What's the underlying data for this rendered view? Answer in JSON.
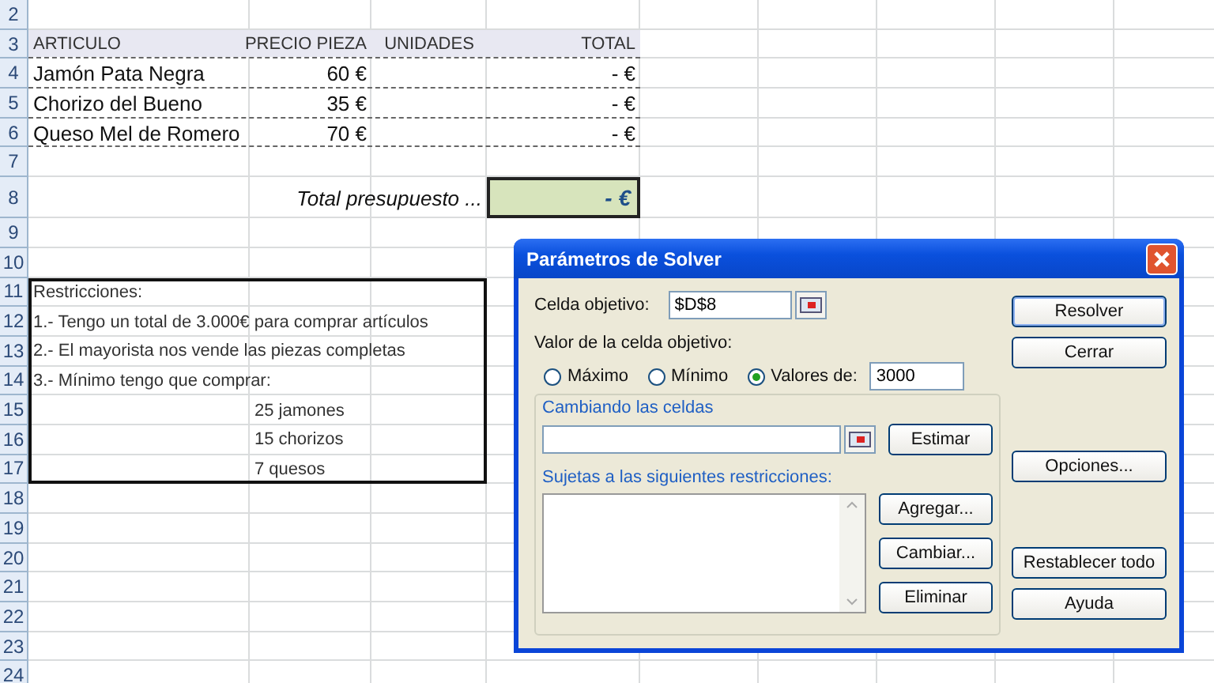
{
  "sheet": {
    "row_numbers": [
      "2",
      "3",
      "4",
      "5",
      "6",
      "7",
      "8",
      "9",
      "10",
      "11",
      "12",
      "13",
      "14",
      "15",
      "16",
      "17",
      "18",
      "19",
      "20",
      "21",
      "22",
      "23",
      "24"
    ],
    "columns": [
      "ARTICULO",
      "PRECIO PIEZA",
      "UNIDADES",
      "TOTAL"
    ],
    "items": [
      {
        "name": "Jamón Pata Negra",
        "price": "60 €",
        "total": "- €"
      },
      {
        "name": "Chorizo del Bueno",
        "price": "35 €",
        "total": "- €"
      },
      {
        "name": "Queso Mel de Romero",
        "price": "70 €",
        "total": "- €"
      }
    ],
    "total": {
      "label": "Total presupuesto ...",
      "value": "- €",
      "selected": true
    },
    "restrictions": [
      {
        "kind": "line",
        "text": "Restricciones:"
      },
      {
        "kind": "line",
        "text": "1.- Tengo un total de 3.000€ para comprar artículos"
      },
      {
        "kind": "line",
        "text": "2.- El mayorista nos vende las piezas completas"
      },
      {
        "kind": "line",
        "text": "3.- Mínimo tengo que comprar:"
      },
      {
        "kind": "indented",
        "text": "25 jamones"
      },
      {
        "kind": "indented",
        "text": "15 chorizos"
      },
      {
        "kind": "indented",
        "text": "7 quesos"
      }
    ]
  },
  "dialog": {
    "title": "Parámetros de Solver",
    "target_label": "Celda objetivo:",
    "target_value": "$D$8",
    "value_label": "Valor de la celda objetivo:",
    "options": [
      {
        "label": "Máximo",
        "selected": false
      },
      {
        "label": "Mínimo",
        "selected": false
      },
      {
        "label": "Valores de:",
        "selected": true
      }
    ],
    "value_field": "3000",
    "changing_legend": "Cambiando las celdas",
    "estimate_button": "Estimar",
    "constraints_legend": "Sujetas a las siguientes restricciones:",
    "constraint_buttons": [
      "Agregar...",
      "Cambiar...",
      "Eliminar"
    ],
    "side_buttons_top": [
      "Resolver",
      "Cerrar",
      "Opciones..."
    ],
    "side_buttons_bottom": [
      "Restablecer todo",
      "Ayuda"
    ]
  }
}
